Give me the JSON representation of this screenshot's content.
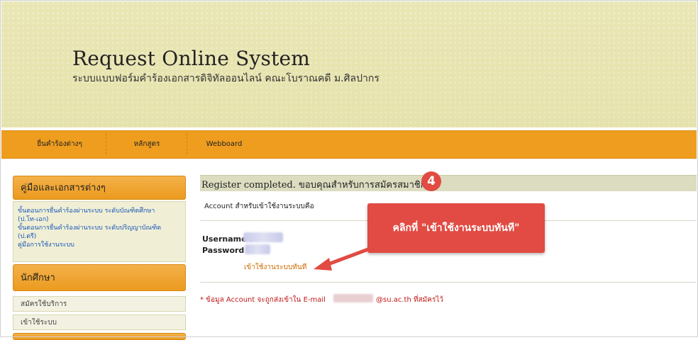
{
  "header": {
    "title": "Request Online System",
    "subtitle": "ระบบแบบฟอร์มคำร้องเอกสารดิจิทัลออนไลน์ คณะโบราณคดี ม.ศิลปากร"
  },
  "nav": {
    "items": [
      "ยื่นคำร้องต่างๆ",
      "หลักสูตร",
      "Webboard"
    ]
  },
  "sidebar": {
    "guides_heading": "คู่มือและเอกสารต่างๆ",
    "guide_links": [
      "ขั้นตอนการยื่นคำร้องผ่านระบบ ระดับบัณฑิตศึกษา",
      "(ป.โท-เอก)",
      "ขั้นตอนการยื่นคำร้องผ่านระบบ ระดับปริญญาบัณฑิต",
      "(ป.ตรี)",
      "คู่มือการใช้งานระบบ"
    ],
    "students_heading": "นักศึกษา",
    "student_items": [
      "สมัครใช้บริการ",
      "เข้าใช้ระบบ"
    ]
  },
  "main": {
    "register_message": "Register completed. ขอบคุณสำหรับการสมัครสมาชิก",
    "step_badge": "4",
    "account_note": "Account สำหรับเข้าใช้งานระบบคือ",
    "username_label": "Username :",
    "password_label": "Password :",
    "login_link": "เข้าใช้งานระบบทันที",
    "info_note": "* ข้อมูล Account จะถูกส่งเข้าใน E-mail",
    "info_tail": "@su.ac.th ที่สมัครไว้"
  },
  "callout": {
    "text": "คลิกที่ \"เข้าใช้งานระบบทันที\"",
    "color": "#e14b43"
  },
  "colors": {
    "nav_orange": "#ef9d1f",
    "banner": "#e9e6b4",
    "link_blue": "#1a56b6",
    "alert_red": "#c01818"
  }
}
